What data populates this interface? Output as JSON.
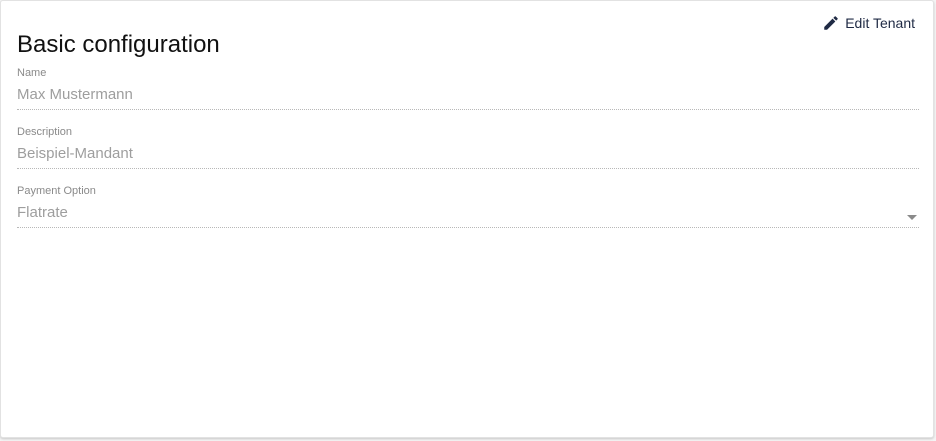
{
  "card": {
    "title": "Basic configuration",
    "edit_label": "Edit Tenant",
    "edit_icon": "pencil-icon",
    "accent_color": "#1f2a44"
  },
  "fields": {
    "name": {
      "label": "Name",
      "value": "Max Mustermann"
    },
    "description": {
      "label": "Description",
      "value": "Beispiel-Mandant"
    },
    "payment": {
      "label": "Payment Option",
      "value": "Flatrate",
      "icon": "caret-down-icon"
    }
  }
}
